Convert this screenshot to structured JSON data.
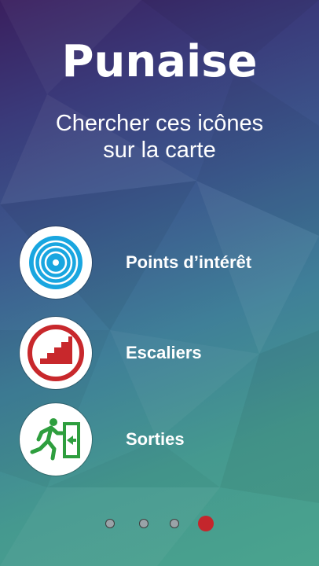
{
  "colors": {
    "accent_active_dot": "#c4262c",
    "poi_blue": "#19a6e0",
    "stairs_red": "#c8282c",
    "exit_green": "#2e9e3e"
  },
  "header": {
    "title": "Punaise",
    "subtitle_line1": "Chercher ces icônes",
    "subtitle_line2": "sur la carte"
  },
  "legend": {
    "items": [
      {
        "icon": "points-of-interest-icon",
        "label": "Points d’intérêt"
      },
      {
        "icon": "stairs-icon",
        "label": "Escaliers"
      },
      {
        "icon": "exit-icon",
        "label": "Sorties"
      }
    ]
  },
  "pager": {
    "total_pages": 4,
    "current_page": 4
  }
}
